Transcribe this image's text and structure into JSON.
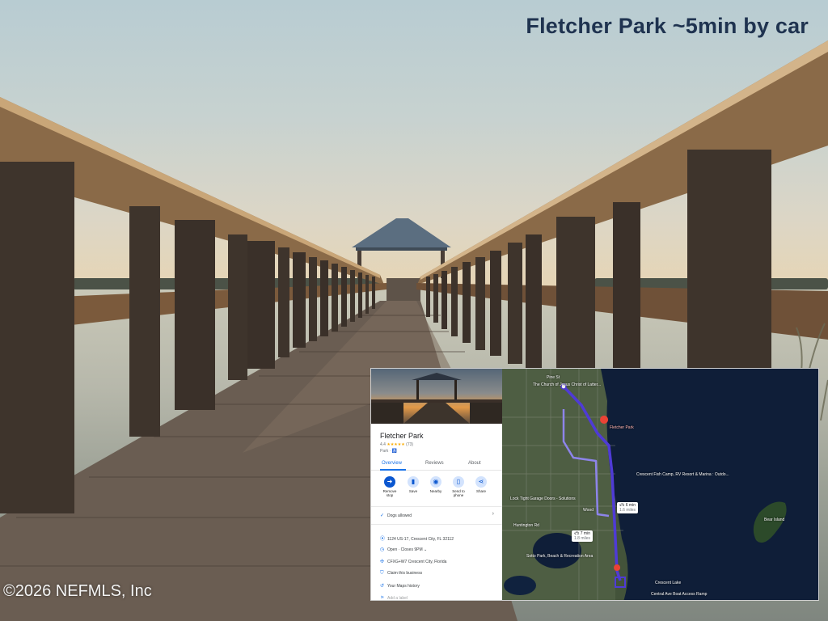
{
  "photo": {
    "headline": "Fletcher Park ~5min by car",
    "watermark": "©2026 NEFMLS, Inc",
    "colors": {
      "headline": "#1f3350",
      "sky_top": "#b8ccd2",
      "horizon": "#e7d5b4",
      "wood": "#8a6a48"
    }
  },
  "inset": {
    "place": {
      "name": "Fletcher Park",
      "rating": "4.4",
      "stars": "★★★★★",
      "review_count": "(73)",
      "category": "Park · ♿"
    },
    "tabs": [
      "Overview",
      "Reviews",
      "About"
    ],
    "actions": [
      {
        "label": "Remove stop",
        "icon": "directions-icon"
      },
      {
        "label": "Save",
        "icon": "bookmark-icon"
      },
      {
        "label": "Nearby",
        "icon": "nearby-icon"
      },
      {
        "label": "Send to phone",
        "icon": "phone-icon"
      },
      {
        "label": "Share",
        "icon": "share-icon"
      }
    ],
    "amenity": "Dogs allowed",
    "details": {
      "address": "1124 US-17, Crescent City, FL 32112",
      "hours": "Open · Closes 9PM",
      "plus_code": "CFXG+W7 Crescent City, Florida",
      "claim": "Claim this business",
      "history": "Your Maps history",
      "add_label": "Add a label"
    },
    "map": {
      "labels": {
        "fletcher": "Fletcher Park",
        "church": "The Church of Jesus Christ of Latter...",
        "crescent_fish": "Crescent Fish Camp, RV Resort & Marina : Outdo...",
        "lock_tight": "Lock Tight Garage Doors - Solutions",
        "huntington": "Huntington Rd",
        "sotto": "Sotto Park, Beach & Recreation Area",
        "crescent_lake": "Crescent Lake",
        "central_ave": "Central Ave Boat Access Ramp",
        "bear_island": "Bear Island",
        "pine_st": "Pine St",
        "wood": "Wood"
      },
      "chips": {
        "route_a": "6 min",
        "route_a_dist": "1.6 miles",
        "route_b": "7 min",
        "route_b_dist": "1.8 miles"
      },
      "route_color": "#4f3bd6"
    }
  }
}
